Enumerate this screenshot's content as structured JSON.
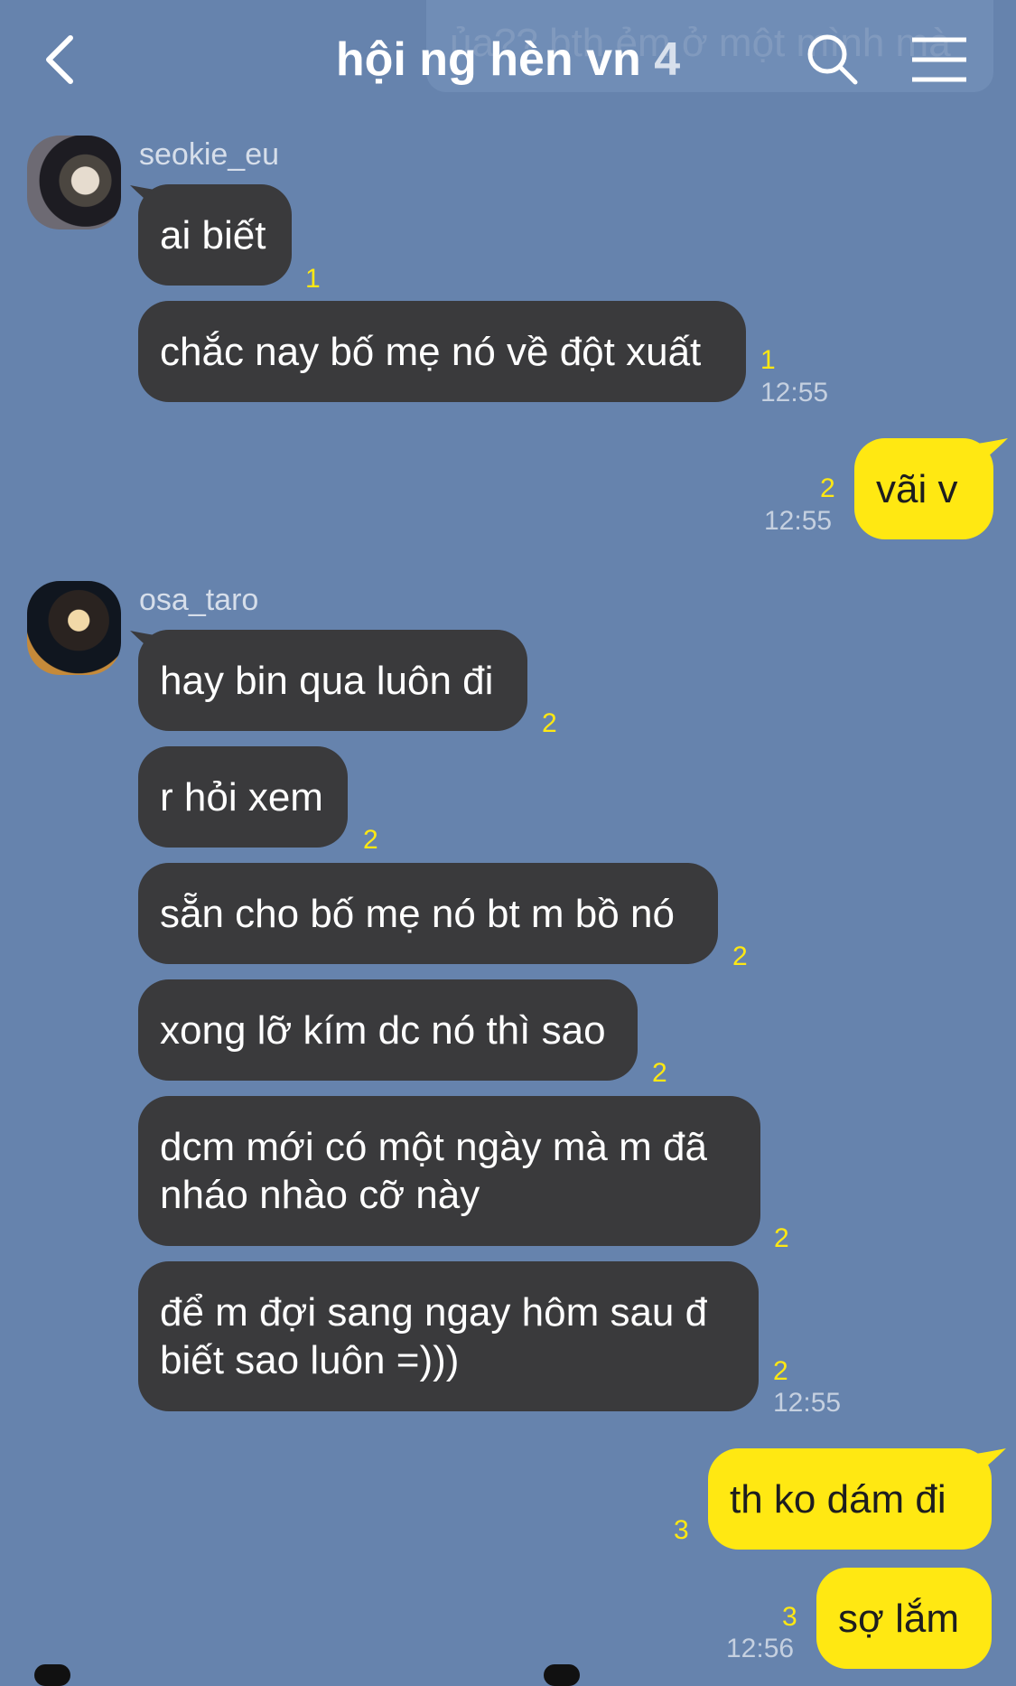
{
  "header": {
    "title": "hội ng hèn vn",
    "member_count": "4",
    "ghost_banner": "ủa?? bth ẻm ở một mình mà"
  },
  "messages": [
    {
      "sender": "seokie_eu",
      "text": "ai biết",
      "read": "1",
      "time": ""
    },
    {
      "sender": "seokie_eu",
      "text": "chắc nay bố mẹ nó về đột xuất",
      "read": "1",
      "time": "12:55"
    },
    {
      "sender": "me",
      "text": "vãi v",
      "read": "2",
      "time": "12:55"
    },
    {
      "sender": "osa_taro",
      "text": "hay bin qua luôn đi",
      "read": "2",
      "time": ""
    },
    {
      "sender": "osa_taro",
      "text": "r hỏi xem",
      "read": "2",
      "time": ""
    },
    {
      "sender": "osa_taro",
      "text": "sẵn cho bố mẹ nó bt m bồ nó",
      "read": "2",
      "time": ""
    },
    {
      "sender": "osa_taro",
      "text": "xong lỡ kím dc nó thì sao",
      "read": "2",
      "time": ""
    },
    {
      "sender": "osa_taro",
      "text": "dcm mới có một ngày mà m đã nháo nhào cỡ này",
      "read": "2",
      "time": ""
    },
    {
      "sender": "osa_taro",
      "text": "để m đợi sang ngay hôm sau đ biết sao luôn =)))",
      "read": "2",
      "time": "12:55"
    },
    {
      "sender": "me",
      "text": "th ko dám đi",
      "read": "3",
      "time": ""
    },
    {
      "sender": "me",
      "text": "sợ lắm",
      "read": "3",
      "time": "12:56"
    }
  ],
  "colors": {
    "background": "#6683ad",
    "incoming_bubble": "#3a3a3c",
    "outgoing_bubble": "#ffe812",
    "read_count": "#ffe812"
  },
  "icons": [
    "back-icon",
    "search-icon",
    "menu-icon"
  ]
}
